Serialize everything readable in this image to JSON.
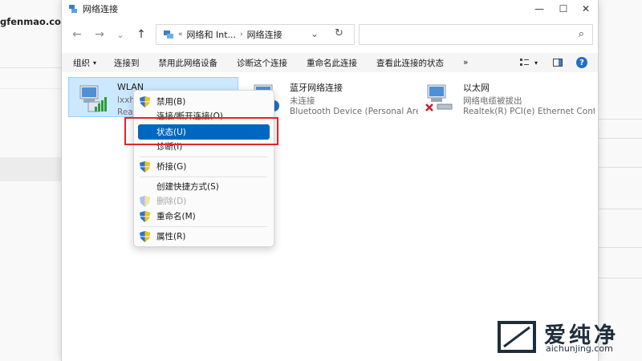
{
  "background": {
    "url_fragment": "gfenmao.com)"
  },
  "window": {
    "title": "网络连接",
    "controls": {
      "minimize": "—",
      "maximize": "☐",
      "close": "✕"
    }
  },
  "address_bar": {
    "back": "←",
    "forward": "→",
    "recent": "⌄",
    "up": "↑",
    "crumbs": [
      "网络和 Int...",
      "网络连接"
    ],
    "crumb_sep": "›",
    "leading_sep": "«",
    "dropdown": "⌄",
    "refresh": "↻",
    "search_icon": "⌕"
  },
  "toolbar": {
    "organize": "组织",
    "organize_caret": "▾",
    "connect_to": "连接到",
    "disable_device": "禁用此网络设备",
    "diagnose": "诊断这个连接",
    "rename": "重命名此连接",
    "view_status": "查看此连接的状态",
    "more": "»",
    "view_caret": "▾",
    "help": "?"
  },
  "connections": [
    {
      "name": "WLAN",
      "status": "lxxhz.c",
      "device": "Realtek"
    },
    {
      "name": "蓝牙网络连接",
      "status": "未连接",
      "device": "Bluetooth Device (Personal Are..."
    },
    {
      "name": "以太网",
      "status": "网络电缆被拔出",
      "device": "Realtek(R) PCI(e) Ethernet Cont..."
    }
  ],
  "context_menu": {
    "disable": "禁用(B)",
    "connect_disconnect": "连接/断开连接(O)",
    "status": "状态(U)",
    "diagnose": "诊断(I)",
    "bridge": "桥接(G)",
    "create_shortcut": "创建快捷方式(S)",
    "delete": "删除(D)",
    "rename": "重命名(M)",
    "properties": "属性(R)"
  },
  "watermark": {
    "cn": "爱纯净",
    "en": "aichunjing.com"
  },
  "colors": {
    "accent": "#0067c0",
    "highlight_box": "#e0262b",
    "selection": "#cce8ff"
  }
}
